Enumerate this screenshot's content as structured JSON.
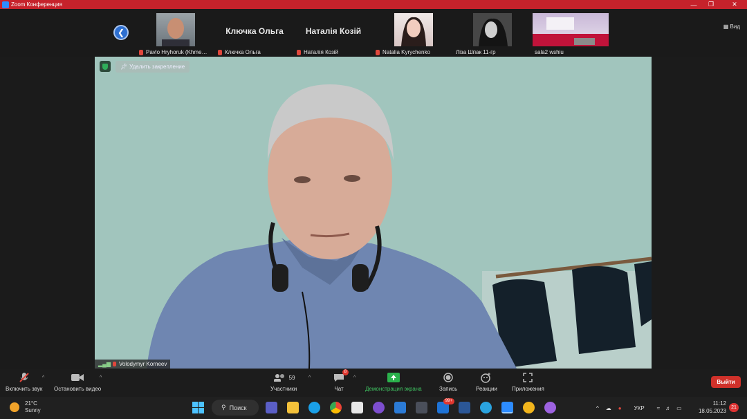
{
  "window": {
    "title": "Zoom Конференция"
  },
  "gallery": [
    {
      "name": "Pavlo Hryhoruk (Khme…",
      "has_photo": true
    },
    {
      "name": "Ключка Ольга",
      "display_name": "Ключка Ольга",
      "has_photo": false
    },
    {
      "name": "Наталія Козій",
      "display_name": "Наталія Козій",
      "has_photo": false
    },
    {
      "name": "Natalia Kyrychenko",
      "has_photo": true
    },
    {
      "name": "Ліза Шпак 11-гр",
      "has_photo": true
    },
    {
      "name": "sala2 wshiu",
      "has_photo": true
    }
  ],
  "view_label": "Вид",
  "stage": {
    "unpin_label": "Удалить закрепление",
    "speaker_name": "Volodymyr Korneev"
  },
  "toolbar": {
    "unmute_label": "Включить звук",
    "start_video_label": "Остановить видео",
    "participants_label": "Участники",
    "participants_count": "59",
    "chat_label": "Чат",
    "chat_badge": "8",
    "share_label": "Демонстрация экрана",
    "record_label": "Запись",
    "reactions_label": "Реакции",
    "apps_label": "Приложения",
    "leave_label": "Выйти"
  },
  "colors": {
    "accent_share": "#2bb24c",
    "leave": "#d0312a",
    "titlebar": "#c6222b"
  },
  "taskbar": {
    "temperature": "21°C",
    "weather": "Sunny",
    "search_label": "Поиск",
    "mail_badge": "99+",
    "language": "УКР",
    "time": "11:12",
    "date": "18.05.2023",
    "notifications": "21"
  }
}
